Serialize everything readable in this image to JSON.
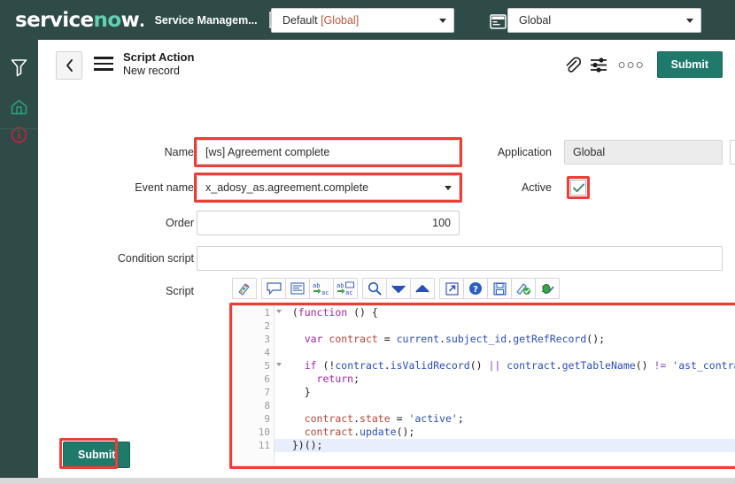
{
  "topnav": {
    "brand_service": "service",
    "brand_n": "n",
    "brand_o": "o",
    "brand_w": "w",
    "brand_dot": ".",
    "app_name": "Service Managem...",
    "doc_icon": "document-icon",
    "scope": {
      "label_prefix": "Default ",
      "label_scope": "[Global]",
      "icon": "chevron-down-icon"
    },
    "domain": {
      "value": "Global",
      "icon": "window-icon"
    }
  },
  "rail": {
    "items": [
      {
        "name": "filter-icon",
        "title": "Filter navigator"
      },
      {
        "name": "home-icon",
        "title": "Home"
      },
      {
        "name": "info-icon",
        "title": "Information"
      }
    ]
  },
  "formhead": {
    "back_icon": "chevron-left-icon",
    "menu_icon": "hamburger-icon",
    "title": "Script Action",
    "subtitle": "New record",
    "attachment_icon": "paperclip-icon",
    "personalize_icon": "sliders-icon",
    "more_icon": "ellipsis-icon",
    "more_label": "○○○",
    "submit_label": "Submit"
  },
  "form": {
    "name": {
      "label": "Name",
      "value": "[ws] Agreement complete"
    },
    "application": {
      "label": "Application",
      "value": "Global",
      "info_icon": "info-circle-icon"
    },
    "event_name": {
      "label": "Event name",
      "value": "x_adosy_as.agreement.complete"
    },
    "active": {
      "label": "Active",
      "checked": true,
      "check_icon": "check-icon"
    },
    "order": {
      "label": "Order",
      "value": "100"
    },
    "condition_script": {
      "label": "Condition script",
      "value": ""
    },
    "script": {
      "label": "Script"
    }
  },
  "editor_toolbar": {
    "buttons": [
      {
        "name": "format-script-icon",
        "title": "Format script"
      },
      {
        "name": "comment-icon",
        "title": "Toggle comment"
      },
      {
        "name": "indent-icon",
        "title": "Indent"
      },
      {
        "name": "replace-icon",
        "title": "Replace"
      },
      {
        "name": "replace-all-icon",
        "title": "Replace all"
      },
      {
        "name": "search-icon",
        "title": "Find"
      },
      {
        "name": "chevron-down-icon",
        "title": "Find next"
      },
      {
        "name": "chevron-up-icon",
        "title": "Find previous"
      },
      {
        "name": "expand-icon",
        "title": "Full screen"
      },
      {
        "name": "help-icon",
        "title": "Help"
      },
      {
        "name": "save-icon",
        "title": "Save"
      },
      {
        "name": "syntax-check-icon",
        "title": "Syntax check"
      },
      {
        "name": "debug-icon",
        "title": "Debug script"
      }
    ]
  },
  "code": {
    "lines": [
      {
        "n": "1",
        "fold": true,
        "active": false,
        "tokens": [
          {
            "t": "plain",
            "v": "  ("
          },
          {
            "t": "kw",
            "v": "function"
          },
          {
            "t": "plain",
            "v": " () {"
          }
        ]
      },
      {
        "n": "2",
        "fold": false,
        "active": false,
        "tokens": [
          {
            "t": "plain",
            "v": ""
          }
        ]
      },
      {
        "n": "3",
        "fold": false,
        "active": false,
        "tokens": [
          {
            "t": "plain",
            "v": "    "
          },
          {
            "t": "kw",
            "v": "var"
          },
          {
            "t": "plain",
            "v": " "
          },
          {
            "t": "id",
            "v": "contract"
          },
          {
            "t": "plain",
            "v": " = "
          },
          {
            "t": "ob",
            "v": "current"
          },
          {
            "t": "plain",
            "v": "."
          },
          {
            "t": "ob",
            "v": "subject_id"
          },
          {
            "t": "plain",
            "v": "."
          },
          {
            "t": "ob",
            "v": "getRefRecord"
          },
          {
            "t": "plain",
            "v": "();"
          }
        ]
      },
      {
        "n": "4",
        "fold": false,
        "active": false,
        "tokens": [
          {
            "t": "plain",
            "v": ""
          }
        ]
      },
      {
        "n": "5",
        "fold": true,
        "active": false,
        "tokens": [
          {
            "t": "plain",
            "v": "    "
          },
          {
            "t": "kw",
            "v": "if"
          },
          {
            "t": "plain",
            "v": " (!"
          },
          {
            "t": "ob",
            "v": "contract"
          },
          {
            "t": "plain",
            "v": "."
          },
          {
            "t": "ob",
            "v": "isValidRecord"
          },
          {
            "t": "plain",
            "v": "() "
          },
          {
            "t": "op",
            "v": "||"
          },
          {
            "t": "plain",
            "v": " "
          },
          {
            "t": "ob",
            "v": "contract"
          },
          {
            "t": "plain",
            "v": "."
          },
          {
            "t": "ob",
            "v": "getTableName"
          },
          {
            "t": "plain",
            "v": "() "
          },
          {
            "t": "op",
            "v": "!="
          },
          {
            "t": "plain",
            "v": " "
          },
          {
            "t": "st",
            "v": "'ast_contract'"
          },
          {
            "t": "plain",
            "v": ") {"
          }
        ]
      },
      {
        "n": "6",
        "fold": false,
        "active": false,
        "tokens": [
          {
            "t": "plain",
            "v": "      "
          },
          {
            "t": "kw",
            "v": "return"
          },
          {
            "t": "plain",
            "v": ";"
          }
        ]
      },
      {
        "n": "7",
        "fold": false,
        "active": false,
        "tokens": [
          {
            "t": "plain",
            "v": "    }"
          }
        ]
      },
      {
        "n": "8",
        "fold": false,
        "active": false,
        "tokens": [
          {
            "t": "plain",
            "v": ""
          }
        ]
      },
      {
        "n": "9",
        "fold": false,
        "active": false,
        "tokens": [
          {
            "t": "plain",
            "v": "    "
          },
          {
            "t": "id",
            "v": "contract"
          },
          {
            "t": "plain",
            "v": "."
          },
          {
            "t": "id",
            "v": "state"
          },
          {
            "t": "plain",
            "v": " = "
          },
          {
            "t": "st",
            "v": "'active'"
          },
          {
            "t": "plain",
            "v": ";"
          }
        ]
      },
      {
        "n": "10",
        "fold": false,
        "active": false,
        "tokens": [
          {
            "t": "plain",
            "v": "    "
          },
          {
            "t": "id",
            "v": "contract"
          },
          {
            "t": "plain",
            "v": "."
          },
          {
            "t": "ob",
            "v": "update"
          },
          {
            "t": "plain",
            "v": "();"
          }
        ]
      },
      {
        "n": "11",
        "fold": false,
        "active": true,
        "tokens": [
          {
            "t": "plain",
            "v": "  })();"
          }
        ]
      }
    ]
  },
  "bottom": {
    "submit_label": "Submit"
  },
  "colors": {
    "nav_bg": "#2e4b48",
    "accent_teal": "#1f7a6b",
    "highlight_red": "#ee3d36",
    "logo_green": "#62d0b1",
    "home_green": "#2f9e7e",
    "info_red": "#c8203f"
  }
}
